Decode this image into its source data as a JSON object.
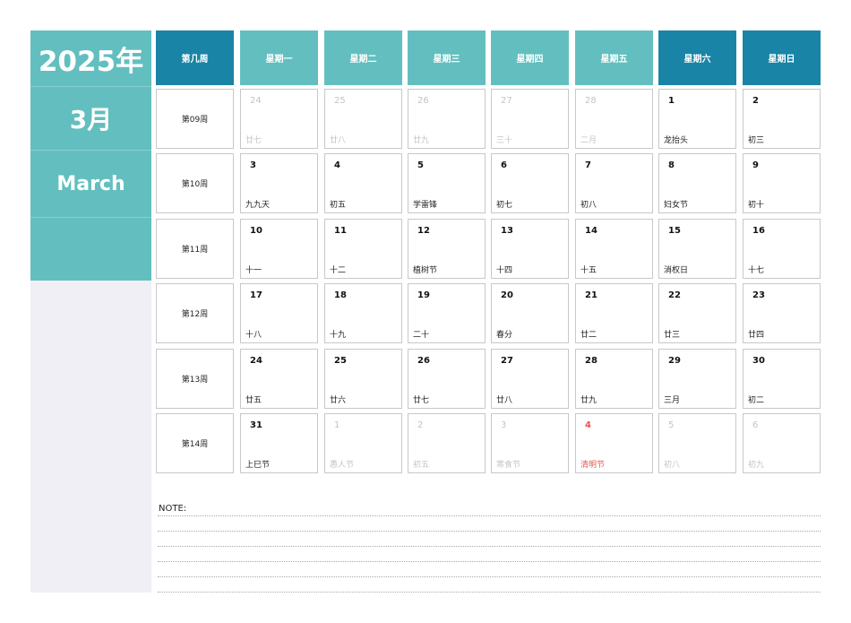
{
  "sidebar": {
    "year": "2025年",
    "month_cn": "3月",
    "month_en": "March"
  },
  "header": {
    "week_col": "第几周",
    "days": [
      "星期一",
      "星期二",
      "星期三",
      "星期四",
      "星期五",
      "星期六",
      "星期日"
    ]
  },
  "rows": [
    {
      "week": "第09周",
      "days": [
        {
          "n": "24",
          "l": "廿七",
          "s": "other"
        },
        {
          "n": "25",
          "l": "廿八",
          "s": "other"
        },
        {
          "n": "26",
          "l": "廿九",
          "s": "other"
        },
        {
          "n": "27",
          "l": "三十",
          "s": "other"
        },
        {
          "n": "28",
          "l": "二月",
          "s": "other"
        },
        {
          "n": "1",
          "l": "龙抬头",
          "s": ""
        },
        {
          "n": "2",
          "l": "初三",
          "s": ""
        }
      ]
    },
    {
      "week": "第10周",
      "days": [
        {
          "n": "3",
          "l": "九九天",
          "s": ""
        },
        {
          "n": "4",
          "l": "初五",
          "s": ""
        },
        {
          "n": "5",
          "l": "学雷锋",
          "s": ""
        },
        {
          "n": "6",
          "l": "初七",
          "s": ""
        },
        {
          "n": "7",
          "l": "初八",
          "s": ""
        },
        {
          "n": "8",
          "l": "妇女节",
          "s": ""
        },
        {
          "n": "9",
          "l": "初十",
          "s": ""
        }
      ]
    },
    {
      "week": "第11周",
      "days": [
        {
          "n": "10",
          "l": "十一",
          "s": ""
        },
        {
          "n": "11",
          "l": "十二",
          "s": ""
        },
        {
          "n": "12",
          "l": "植树节",
          "s": ""
        },
        {
          "n": "13",
          "l": "十四",
          "s": ""
        },
        {
          "n": "14",
          "l": "十五",
          "s": ""
        },
        {
          "n": "15",
          "l": "消权日",
          "s": ""
        },
        {
          "n": "16",
          "l": "十七",
          "s": ""
        }
      ]
    },
    {
      "week": "第12周",
      "days": [
        {
          "n": "17",
          "l": "十八",
          "s": ""
        },
        {
          "n": "18",
          "l": "十九",
          "s": ""
        },
        {
          "n": "19",
          "l": "二十",
          "s": ""
        },
        {
          "n": "20",
          "l": "春分",
          "s": ""
        },
        {
          "n": "21",
          "l": "廿二",
          "s": ""
        },
        {
          "n": "22",
          "l": "廿三",
          "s": ""
        },
        {
          "n": "23",
          "l": "廿四",
          "s": ""
        }
      ]
    },
    {
      "week": "第13周",
      "days": [
        {
          "n": "24",
          "l": "廿五",
          "s": ""
        },
        {
          "n": "25",
          "l": "廿六",
          "s": ""
        },
        {
          "n": "26",
          "l": "廿七",
          "s": ""
        },
        {
          "n": "27",
          "l": "廿八",
          "s": ""
        },
        {
          "n": "28",
          "l": "廿九",
          "s": ""
        },
        {
          "n": "29",
          "l": "三月",
          "s": ""
        },
        {
          "n": "30",
          "l": "初二",
          "s": ""
        }
      ]
    },
    {
      "week": "第14周",
      "days": [
        {
          "n": "31",
          "l": "上巳节",
          "s": ""
        },
        {
          "n": "1",
          "l": "愚人节",
          "s": "other"
        },
        {
          "n": "2",
          "l": "初五",
          "s": "other"
        },
        {
          "n": "3",
          "l": "寒食节",
          "s": "other"
        },
        {
          "n": "4",
          "l": "清明节",
          "s": "hol"
        },
        {
          "n": "5",
          "l": "初八",
          "s": "other"
        },
        {
          "n": "6",
          "l": "初九",
          "s": "other"
        }
      ]
    }
  ],
  "note_label": "NOTE:",
  "colors": {
    "teal": "#63bfbf",
    "weekend_header": "#1a84a6",
    "holiday": "#e8554e"
  }
}
